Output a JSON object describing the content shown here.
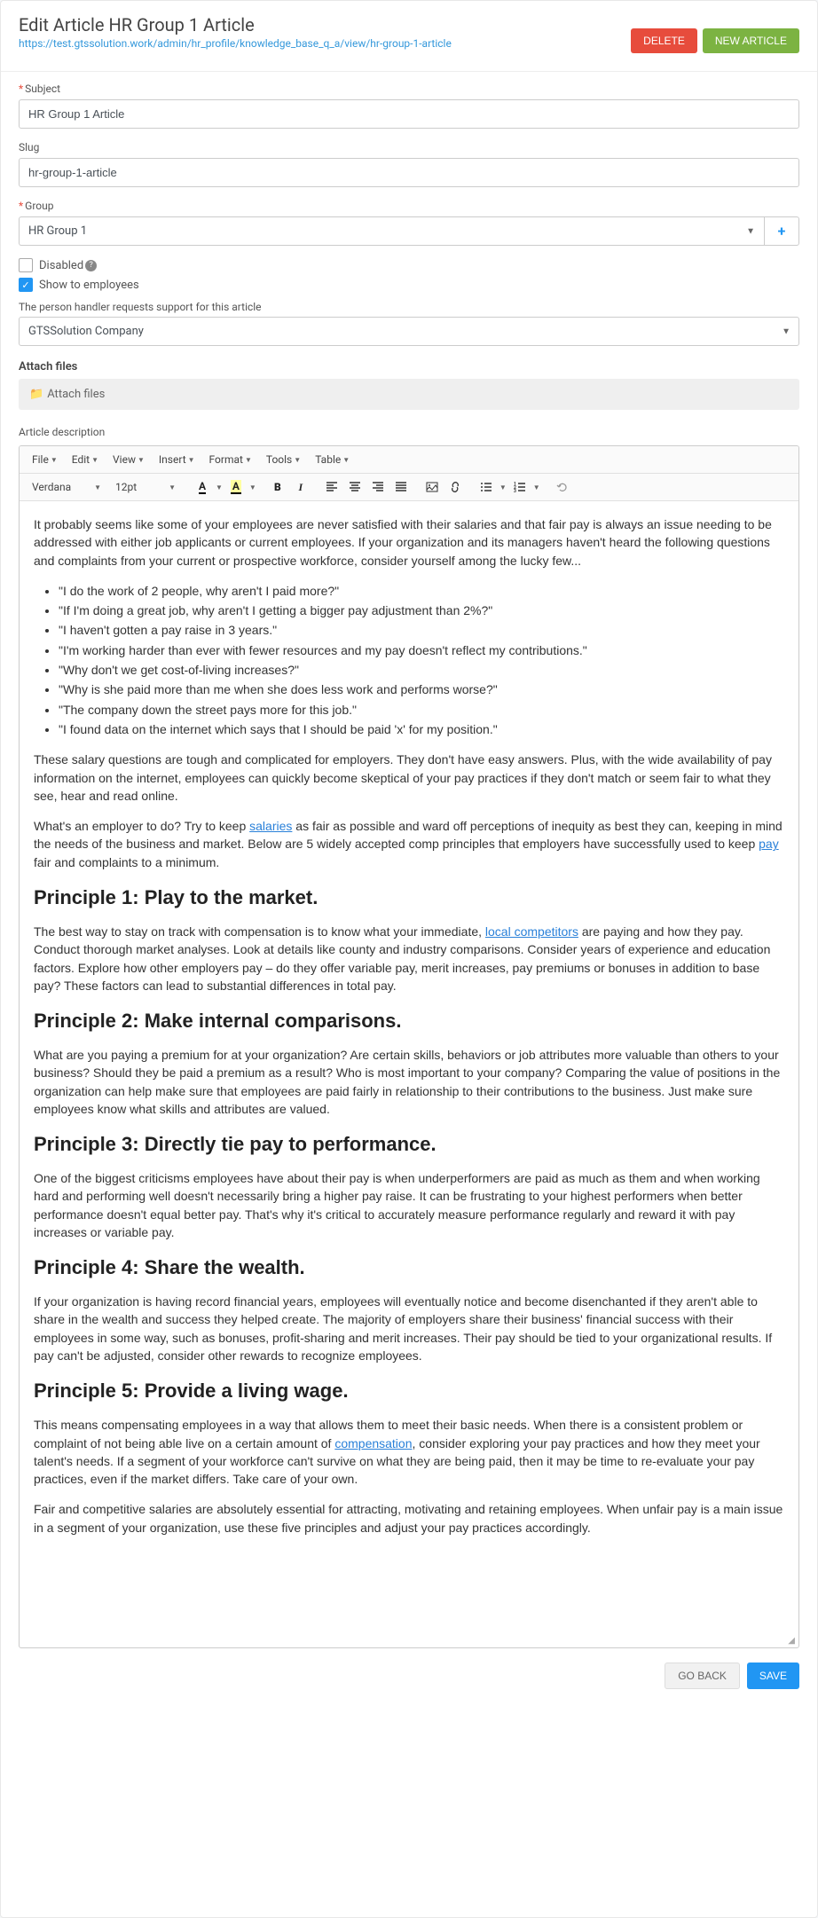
{
  "header": {
    "title": "Edit Article HR Group 1 Article",
    "url": "https://test.gtssolution.work/admin/hr_profile/knowledge_base_q_a/view/hr-group-1-article",
    "delete_label": "DELETE",
    "new_label": "NEW ARTICLE"
  },
  "fields": {
    "subject_label": "Subject",
    "subject_value": "HR Group 1 Article",
    "slug_label": "Slug",
    "slug_value": "hr-group-1-article",
    "group_label": "Group",
    "group_value": "HR Group 1",
    "disabled_label": "Disabled",
    "show_employees_label": "Show to employees",
    "handler_label": "The person handler requests support for this article",
    "handler_value": "GTSSolution Company"
  },
  "attach": {
    "section_label": "Attach files",
    "button_label": "Attach files"
  },
  "desc": {
    "label": "Article description"
  },
  "toolbar": {
    "file": "File",
    "edit": "Edit",
    "view": "View",
    "insert": "Insert",
    "format": "Format",
    "tools": "Tools",
    "table": "Table",
    "font_name": "Verdana",
    "font_size": "12pt"
  },
  "content": {
    "p1": "It probably seems like some of your employees are never satisfied with their salaries and that fair pay is always an issue needing to be addressed with either job applicants or current employees. If your organization and its managers haven't heard the following questions and complaints from your current or prospective workforce, consider yourself among the lucky few...",
    "li1": "\"I do the work of 2 people, why aren't I paid more?\"",
    "li2": "\"If I'm doing a great job, why aren't I getting a bigger pay adjustment than 2%?\"",
    "li3": "\"I haven't gotten a pay raise in 3 years.\"",
    "li4": "\"I'm working harder than ever with fewer resources and my pay doesn't reflect my contributions.\"",
    "li5": "\"Why don't we get cost-of-living increases?\"",
    "li6": "\"Why is she paid more than me when she does less work and performs worse?\"",
    "li7": "\"The company down the street pays more for this job.\"",
    "li8": "\"I found data on the internet which says that I should be paid 'x' for my position.\"",
    "p2": "These salary questions are tough and complicated for employers. They don't have easy answers. Plus, with the wide availability of pay information on the internet, employees can quickly become skeptical of your pay practices if they don't match or seem fair to what they see, hear and read online.",
    "p3a": "What's an employer to do? Try to keep ",
    "p3_link1": "salaries",
    "p3b": " as fair as possible and ward off perceptions of inequity as best they can, keeping in mind the needs of the business and market. Below are 5 widely accepted comp principles that employers have successfully used to keep ",
    "p3_link2": "pay",
    "p3c": " fair and complaints to a minimum.",
    "h1": "Principle 1: Play to the market.",
    "p4a": "The best way to stay on track with compensation is to know what your immediate, ",
    "p4_link": "local competitors",
    "p4b": " are paying and how they pay. Conduct thorough market analyses. Look at details like county and industry comparisons. Consider years of experience and education factors. Explore how other employers pay – do they offer variable pay, merit increases, pay premiums or bonuses in addition to base pay? These factors can lead to substantial differences in total pay.",
    "h2": "Principle 2: Make internal comparisons.",
    "p5": "What are you paying a premium for at your organization? Are certain skills, behaviors or job attributes more valuable than others to your business? Should they be paid a premium as a result? Who is most important to your company? Comparing the value of positions in the organization can help make sure that employees are paid fairly in relationship to their contributions to the business. Just make sure employees know what skills and attributes are valued.",
    "h3": "Principle 3: Directly tie pay to performance.",
    "p6": "One of the biggest criticisms employees have about their pay is when underperformers are paid as much as them and when working hard and performing well doesn't necessarily bring a higher pay raise. It can be frustrating to your highest performers when better performance doesn't equal better pay. That's why it's critical to accurately measure performance regularly and reward it with pay increases or variable pay.",
    "h4": "Principle 4: Share the wealth.",
    "p7": "If your organization is having record financial years, employees will eventually notice and become disenchanted if they aren't able to share in the wealth and success they helped create. The majority of employers share their business' financial success with their employees in some way, such as bonuses, profit-sharing and merit increases. Their pay should be tied to your organizational results. If pay can't be adjusted, consider other rewards to recognize employees.",
    "h5": "Principle 5: Provide a living wage.",
    "p8a": "This means compensating employees in a way that allows them to meet their basic needs. When there is a consistent problem or complaint of not being able live on a certain amount of ",
    "p8_link": "compensation",
    "p8b": ", consider exploring your pay practices and how they meet your talent's needs. If a segment of your workforce can't survive on what they are being paid, then it may be time to re-evaluate your pay practices, even if the market differs. Take care of your own.",
    "p9": "Fair and competitive salaries are absolutely essential for attracting, motivating and retaining employees. When unfair pay is a main issue in a segment of your organization, use these five principles and adjust your pay practices accordingly."
  },
  "footer": {
    "back_label": "GO BACK",
    "save_label": "SAVE"
  }
}
